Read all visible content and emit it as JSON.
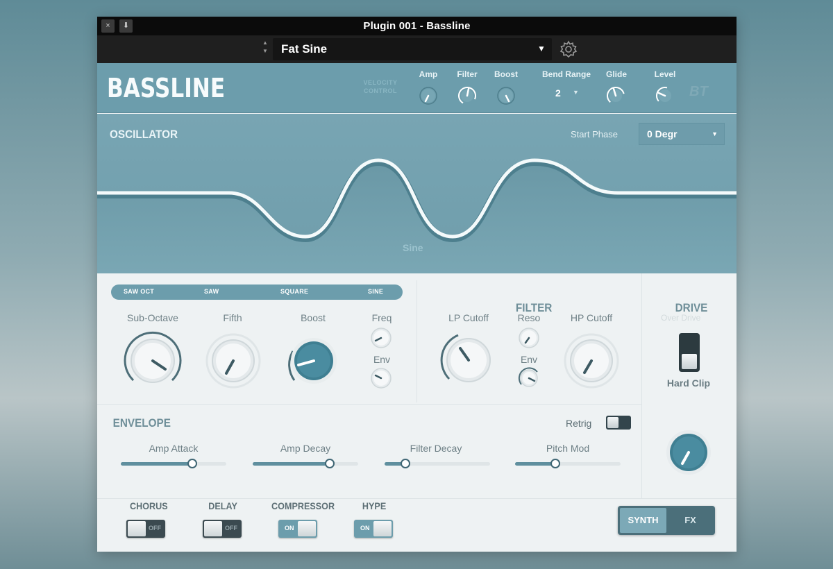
{
  "window": {
    "title": "Plugin 001 - Bassline",
    "close_glyph": "×",
    "pin_glyph": "⬇"
  },
  "preset": {
    "name": "Fat Sine",
    "stepper_up": "▲",
    "stepper_down": "▼",
    "dropdown_glyph": "▼"
  },
  "header": {
    "logo": "BASSLINE",
    "velocity_control": [
      "VELOCITY",
      "CONTROL"
    ],
    "amp_label": "Amp",
    "filter_label": "Filter",
    "boost_label": "Boost",
    "bend_range_label": "Bend Range",
    "bend_range_value": "2",
    "glide_label": "Glide",
    "level_label": "Level",
    "brand_mark": "BT"
  },
  "oscillator": {
    "title": "OSCILLATOR",
    "start_phase_label": "Start Phase",
    "start_phase_value": "0 Degr",
    "wave_name": "Sine"
  },
  "wave_selector": {
    "options": [
      "SAW OCT",
      "SAW",
      "SQUARE",
      "SINE"
    ]
  },
  "osc_controls": {
    "sub_octave": "Sub-Octave",
    "fifth": "Fifth",
    "boost": "Boost",
    "freq": "Freq",
    "env": "Env"
  },
  "filter": {
    "title": "FILTER",
    "lp_cutoff": "LP Cutoff",
    "reso": "Reso",
    "env": "Env",
    "hp_cutoff": "HP Cutoff"
  },
  "drive": {
    "title": "DRIVE",
    "over_drive": "Over Drive",
    "hard_clip": "Hard Clip"
  },
  "envelope": {
    "title": "ENVELOPE",
    "retrig": "Retrig",
    "amp_attack": {
      "label": "Amp Attack",
      "value": 0.68
    },
    "amp_decay": {
      "label": "Amp Decay",
      "value": 0.73
    },
    "filter_decay": {
      "label": "Filter Decay",
      "value": 0.2
    },
    "pitch_mod": {
      "label": "Pitch Mod",
      "value": 0.38
    }
  },
  "fx": {
    "chorus": {
      "label": "CHORUS",
      "state": "OFF"
    },
    "delay": {
      "label": "DELAY",
      "state": "OFF"
    },
    "compressor": {
      "label": "COMPRESSOR",
      "state": "ON"
    },
    "hype": {
      "label": "HYPE",
      "state": "ON"
    }
  },
  "mode": {
    "synth": "SYNTH",
    "fx": "FX",
    "selected": "SYNTH"
  },
  "colors": {
    "accent": "#6c9dac",
    "dark_knob": "#3f7f92",
    "background": "#eef2f3"
  }
}
